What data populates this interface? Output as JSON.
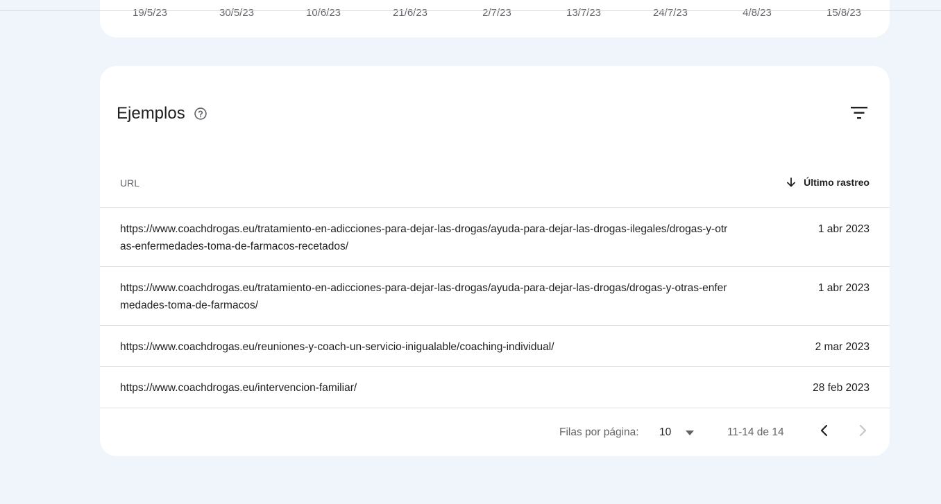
{
  "chart": {
    "x_ticks": [
      "19/5/23",
      "30/5/23",
      "10/6/23",
      "21/6/23",
      "2/7/23",
      "13/7/23",
      "24/7/23",
      "4/8/23",
      "15/8/23"
    ]
  },
  "examples": {
    "title": "Ejemplos",
    "columns": {
      "url": "URL",
      "date": "Último rastreo"
    },
    "rows": [
      {
        "url": "https://www.coachdrogas.eu/tratamiento-en-adicciones-para-dejar-las-drogas/ayuda-para-dejar-las-drogas-ilegales/drogas-y-otras-enfermedades-toma-de-farmacos-recetados/",
        "date": "1 abr 2023"
      },
      {
        "url": "https://www.coachdrogas.eu/tratamiento-en-adicciones-para-dejar-las-drogas/ayuda-para-dejar-las-drogas/drogas-y-otras-enfermedades-toma-de-farmacos/",
        "date": "1 abr 2023"
      },
      {
        "url": "https://www.coachdrogas.eu/reuniones-y-coach-un-servicio-inigualable/coaching-individual/",
        "date": "2 mar 2023"
      },
      {
        "url": "https://www.coachdrogas.eu/intervencion-familiar/",
        "date": "28 feb 2023"
      }
    ],
    "pagination": {
      "rows_per_page_label": "Filas por página:",
      "rows_per_page_value": "10",
      "range_label": "11-14 de 14"
    }
  },
  "icons": {
    "help": "help-circle-icon",
    "filter": "filter-list-icon",
    "sort": "arrow-down-icon",
    "dropdown": "caret-down-icon",
    "prev": "chevron-left-icon",
    "next": "chevron-right-icon"
  },
  "colors": {
    "page_background": "#f0f4fb",
    "card_background": "#ffffff",
    "muted_text": "#5f6368",
    "primary_text": "#1f1f1f",
    "divider": "#e0e0e0"
  }
}
